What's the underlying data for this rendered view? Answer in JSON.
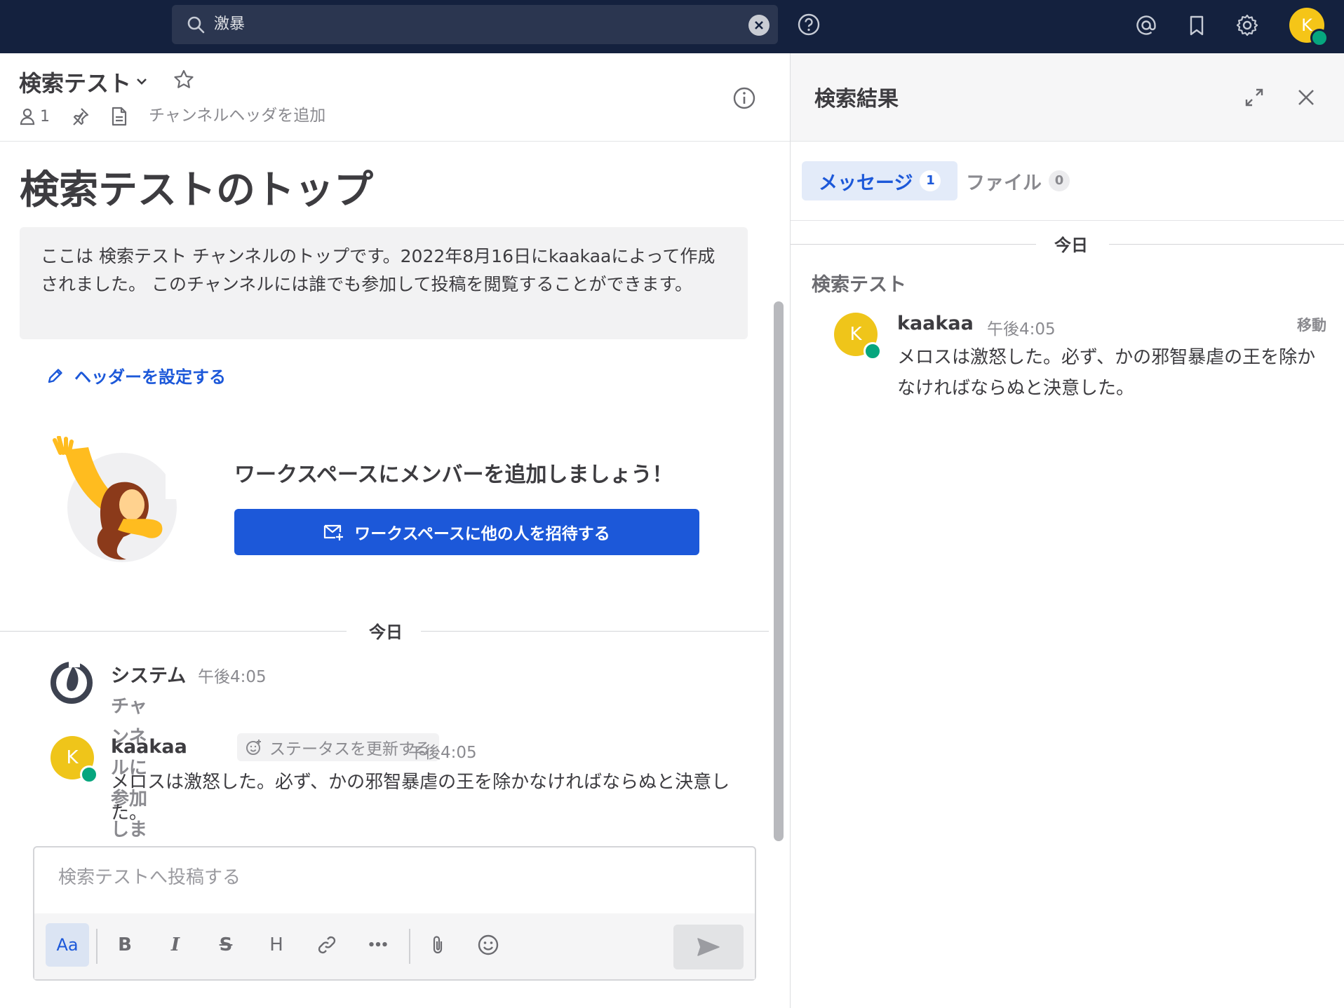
{
  "topbar": {
    "search_value": "激暴",
    "avatar_letter": "K"
  },
  "channel": {
    "name": "検索テスト",
    "member_count": "1",
    "add_header_label": "チャンネルヘッダを追加"
  },
  "intro": {
    "title": "検索テストのトップ",
    "description": "ここは 検索テスト チャンネルのトップです。2022年8月16日にkaakaaによって作成されました。 このチャンネルには誰でも参加して投稿を閲覧することができます。",
    "set_header_label": "ヘッダーを設定する",
    "workspace_title": "ワークスペースにメンバーを追加しましょう！",
    "invite_button": "ワークスペースに他の人を招待する"
  },
  "timeline": {
    "day_label": "今日",
    "posts": [
      {
        "name": "システム",
        "time": "午後4:05",
        "body": "チャンネルに参加しました。"
      },
      {
        "name": "kaakaa",
        "avatar_letter": "K",
        "status_chip": "ステータスを更新する",
        "time": "午後4:05",
        "body": "メロスは激怒した。必ず、かの邪智暴虐の王を除かなければならぬと決意した。"
      }
    ]
  },
  "composer": {
    "placeholder": "検索テストへ投稿する",
    "format_label": "Aa",
    "bold": "B",
    "italic": "I",
    "strike": "S",
    "heading": "H",
    "more": "•••"
  },
  "rhs": {
    "title": "検索結果",
    "tabs": [
      {
        "label": "メッセージ",
        "count": "1"
      },
      {
        "label": "ファイル",
        "count": "0"
      }
    ],
    "day_label": "今日",
    "channel_name": "検索テスト",
    "result": {
      "name": "kaakaa",
      "avatar_letter": "K",
      "time": "午後4:05",
      "jump_label": "移動",
      "body": "メロスは激怒した。必ず、かの邪智暴虐の王を除かなければならぬと決意した。"
    }
  },
  "colors": {
    "topbar": "#14213e",
    "accent": "#1c58d9",
    "avatar": "#efc51a",
    "online": "#06a67e"
  }
}
